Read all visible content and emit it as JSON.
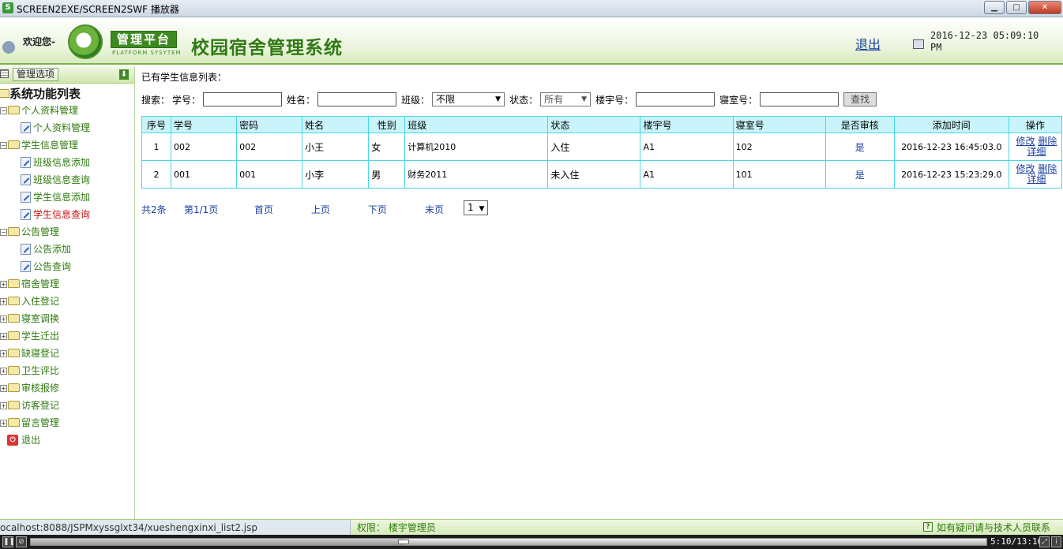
{
  "window": {
    "title": "SCREEN2EXE/SCREEN2SWF 播放器",
    "app_icon": "S"
  },
  "header": {
    "welcome": "欢迎您-",
    "logo_text": "管理平台",
    "logo_sub": "PLATFORM SYSYTEM",
    "system_title": "校园宿舍管理系统",
    "logout": "退出",
    "datetime": "2016-12-23 05:09:10 PM"
  },
  "sidebar": {
    "options_label": "管理选项",
    "root_label": "系统功能列表",
    "groups": [
      {
        "label": "个人资料管理",
        "expanded": true,
        "items": [
          "个人资料管理"
        ]
      },
      {
        "label": "学生信息管理",
        "expanded": true,
        "items": [
          "班级信息添加",
          "班级信息查询",
          "学生信息添加",
          "学生信息查询"
        ]
      },
      {
        "label": "公告管理",
        "expanded": true,
        "items": [
          "公告添加",
          "公告查询"
        ]
      },
      {
        "label": "宿舍管理",
        "expanded": false
      },
      {
        "label": "入住登记",
        "expanded": false
      },
      {
        "label": "寝室调换",
        "expanded": false
      },
      {
        "label": "学生迁出",
        "expanded": false
      },
      {
        "label": "缺寝登记",
        "expanded": false
      },
      {
        "label": "卫生评比",
        "expanded": false
      },
      {
        "label": "审核报修",
        "expanded": false
      },
      {
        "label": "访客登记",
        "expanded": false
      },
      {
        "label": "留言管理",
        "expanded": false
      }
    ],
    "exit_label": "退出",
    "active_item": "学生信息查询"
  },
  "main": {
    "caption": "已有学生信息列表：",
    "search": {
      "prefix": "搜索：",
      "student_no_label": "学号：",
      "student_no_value": "",
      "name_label": "姓名：",
      "name_value": "",
      "class_label": "班级：",
      "class_value": "不限",
      "status_label": "状态：",
      "status_value": "所有",
      "building_label": "楼宇号：",
      "building_value": "",
      "room_label": "寝室号：",
      "room_value": "",
      "find_button": "查找"
    },
    "table": {
      "headers": [
        "序号",
        "学号",
        "密码",
        "姓名",
        "性别",
        "班级",
        "状态",
        "楼宇号",
        "寝室号",
        "是否审核",
        "添加时间",
        "操作"
      ],
      "rows": [
        {
          "index": "1",
          "student_no": "002",
          "password": "002",
          "name": "小王",
          "gender": "女",
          "class": "计算机2010",
          "status": "入住",
          "building": "A1",
          "room": "102",
          "audited": "是",
          "added": "2016-12-23 16:45:03.0",
          "edit": "修改",
          "delete": "删除",
          "detail": "详细"
        },
        {
          "index": "2",
          "student_no": "001",
          "password": "001",
          "name": "小李",
          "gender": "男",
          "class": "财务2011",
          "status": "未入住",
          "building": "A1",
          "room": "101",
          "audited": "是",
          "added": "2016-12-23 15:23:29.0",
          "edit": "修改",
          "delete": "删除",
          "detail": "详细"
        }
      ]
    },
    "pager": {
      "total": "共2条",
      "page_info": "第1/1页",
      "first": "首页",
      "prev": "上页",
      "next": "下页",
      "last": "末页",
      "page_select": "1"
    }
  },
  "statusbar": {
    "url": "ocalhost:8088/JSPMxyssglxt34/xueshengxinxi_list2.jsp",
    "permission": "权限：  楼宇管理员",
    "help": "如有疑问请与技术人员联系"
  },
  "player": {
    "time": "5:10/13:16",
    "progress": 0.39
  },
  "colors": {
    "brand_green": "#2f7a13",
    "table_border": "#4ad6ea",
    "table_header_bg": "#c9f4fb",
    "link_blue": "#1a3fa0",
    "active_red": "#cc1111"
  }
}
